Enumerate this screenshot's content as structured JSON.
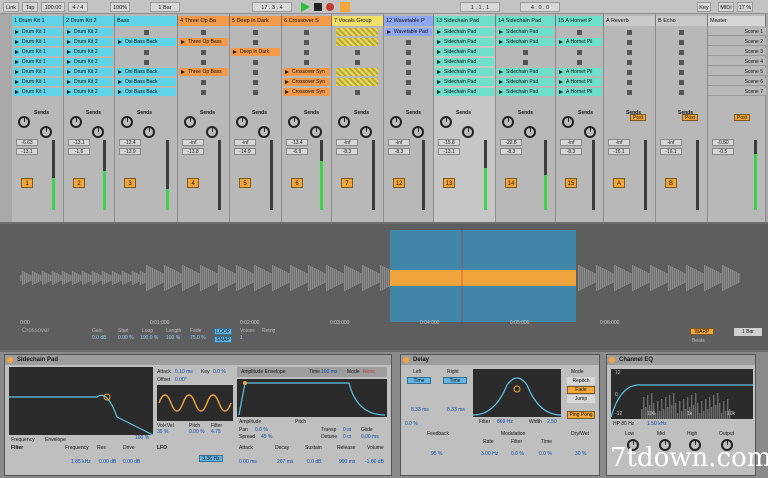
{
  "top": {
    "link": "Link",
    "tap": "Tap",
    "tempo": "100.00",
    "sig": "4 / 4",
    "zoom": "100%",
    "quant": "1 Bar",
    "pos": "17 . 3 . 4",
    "loop_start": "1 . 1 . 1",
    "loop_len": "4 . 0 . 0",
    "key": "Key",
    "midi": "MIDI",
    "cpu": "17 %"
  },
  "tracks": [
    {
      "name": "1 Drum Kit 1",
      "color": "#5fd3e8",
      "num": "1",
      "db": "-6.63",
      "db2": "-13.1",
      "bg": "#b8b8b8"
    },
    {
      "name": "2 Drum Kit 2",
      "color": "#5fd3e8",
      "num": "2",
      "db": "-13.1",
      "db2": "-1.6",
      "bg": "#b8b8b8"
    },
    {
      "name": "Bass",
      "color": "#5fd3e8",
      "num": "3",
      "db": "-12.4",
      "db2": "-13.9",
      "bg": "#b8b8b8"
    },
    {
      "name": "4 Three Op Ba",
      "color": "#f39a4a",
      "num": "4",
      "db": "-inf",
      "db2": "-13.8",
      "bg": "#b8b8b8"
    },
    {
      "name": "5 Deep in Dark",
      "color": "#f39a4a",
      "num": "5",
      "db": "-inf",
      "db2": "-14.9",
      "bg": "#b8b8b8"
    },
    {
      "name": "6 Crossover S",
      "color": "#f39a4a",
      "num": "6",
      "db": "-13.4",
      "db2": "-6.9",
      "bg": "#b8b8b8"
    },
    {
      "name": "7 Vocals Group",
      "color": "#f0e06a",
      "num": "7",
      "db": "-inf",
      "db2": "-8.3",
      "bg": "#b8b8b8"
    },
    {
      "name": "12 Wavetable P",
      "color": "#8fa7f3",
      "num": "12",
      "db": "-inf",
      "db2": "-8.3",
      "bg": "#b8b8b8"
    },
    {
      "name": "13 Sidechain Pad",
      "color": "#6ee0c9",
      "num": "13",
      "db": "-15.8",
      "db2": "-13.1",
      "bg": "#c6c6c6"
    },
    {
      "name": "14 Sidechain Pad",
      "color": "#6ee0c9",
      "num": "14",
      "db": "-22.8",
      "db2": "-8.3",
      "bg": "#b8b8b8"
    },
    {
      "name": "15 A Hornet P",
      "color": "#6ee0c9",
      "num": "15",
      "db": "-inf",
      "db2": "-8.3",
      "bg": "#b8b8b8"
    },
    {
      "name": "A Reverb",
      "color": "#c9c9c9",
      "num": "A",
      "db": "-inf",
      "db2": "-16.1",
      "bg": "#b8b8b8"
    },
    {
      "name": "B Echo",
      "color": "#c9c9c9",
      "num": "B",
      "db": "-inf",
      "db2": "-16.1",
      "bg": "#b8b8b8"
    },
    {
      "name": "Master",
      "color": "#d6d6d6",
      "num": "",
      "db": "-0.50",
      "db2": "-0.5",
      "bg": "#b8b8b8"
    }
  ],
  "clips": {
    "drum1": "Drum Kit 1",
    "drum2": "Drum Kit 2",
    "oxibass": "Oxi Bass Back",
    "threeop": "Three Op Bass",
    "deep": "Deep in Dark",
    "crossover": "Crossover Syn",
    "wavetable": "Wavetable Pad",
    "sidechain": "Sidechain Pad",
    "hornet": "A Hornet Pil"
  },
  "scenes": [
    "Scene 1",
    "Scene 2",
    "Scene 3",
    "Scene 4",
    "Scene 5",
    "Scene 6",
    "Scene 7"
  ],
  "sends": "Sends",
  "post": "Post",
  "clip": {
    "gain": "Gain",
    "gain_v": "0.0 dB",
    "start": "Start",
    "start_v": "0.00 %",
    "loop": "Loop",
    "loop_v": "100.0 %",
    "length": "Length",
    "length_v": "100 %",
    "fade": "Fade",
    "fade_v": "75.0 %",
    "voices": "Voices",
    "voices_v": "1",
    "retrig": "Retrig",
    "loop_btn": "LOOP",
    "snap_btn": "SNAP",
    "crossover_lbl": "Crossover",
    "v_tick_l": "0:00",
    "ticks": [
      "0:00",
      "0:01:000",
      "0:02:000",
      "0:03:000",
      "0:04:000",
      "0:05:000",
      "0:06:000"
    ],
    "warp": "WARP",
    "bar": "1 Bar",
    "beats": "Beats"
  },
  "sampler": {
    "title": "Sidechain Pad",
    "freq": "Frequency",
    "env": "Envelope",
    "attack": "Attack",
    "attack_v": "0.10 ms",
    "key": "Key",
    "key_v": "0.0 %",
    "offset": "Offset",
    "offset_v": "0.00°",
    "amp_env": "Amplitude Envelope",
    "time": "Time",
    "time_v": "100 ms",
    "mode": "Mode",
    "mode_v": "None",
    "filter": "Filter",
    "lfo": "LFO",
    "freq_v": "1.85 kHz",
    "res_v": "0.00 dB",
    "drive_v": "0.00 dB",
    "amp": "Amplitude",
    "pitch": "Pitch",
    "decay": "Decay",
    "decay_v": "267 ms",
    "sustain": "Sustain",
    "sustain_v": "0.0 dB",
    "release": "Release",
    "release_v": "990 ms",
    "volume": "Volume",
    "volume_v": "-1.80 dB",
    "atk_v": "0.00 ms",
    "pan": "Pan",
    "pan_v": "0.0 %",
    "spread": "Spread",
    "spread_v": "45 %",
    "hz": "3.36 Hz",
    "key100": "100 %",
    "res": "Res",
    "drive": "Drive",
    "glide": "Glide",
    "glide_v": "0.00 ms",
    "pitch_v": "0.00 %",
    "filter_v": "4.75",
    "volvel": "Vol<Vel",
    "volvel_v": "35 %",
    "detune": "Detune",
    "detune_v": "0 ct",
    "transp": "Transp",
    "transp_v": "0 st"
  },
  "delay": {
    "title": "Delay",
    "left": "Left",
    "right": "Right",
    "time_btn": "Time",
    "lv": "8.33 ms",
    "rv": "8.33 ms",
    "feedback": "Feedback",
    "feedback_v": "95 %",
    "filter": "Filter",
    "filter_v": "869 Hz",
    "width": "Width",
    "width_v": "2.50",
    "modulation": "Modulation",
    "rate": "Rate",
    "rate_v": "3.00 Hz",
    "ftime": "Filter",
    "ftime_v": "0.0 %",
    "timemod": "Time",
    "timemod_v": "0.0 %",
    "mode": "Mode",
    "repitch": "Repitch",
    "fade": "Fade",
    "jump": "Jump",
    "pingpong": "Ping Pong",
    "drywet": "Dry/Wet",
    "drywet_v": "30 %",
    "pct": "0.0 %"
  },
  "eq": {
    "title": "Channel EQ",
    "db12": "12",
    "db0": "0",
    "dbm12": "-12",
    "low": "Low",
    "mid": "Mid",
    "high": "High",
    "output": "Output",
    "hp": "HP 80 Hz",
    "hpf": "1.50 kHz",
    "khz1": "1k",
    "khz10": "10k",
    "f100": "100"
  },
  "watermark": "7tdown.com"
}
